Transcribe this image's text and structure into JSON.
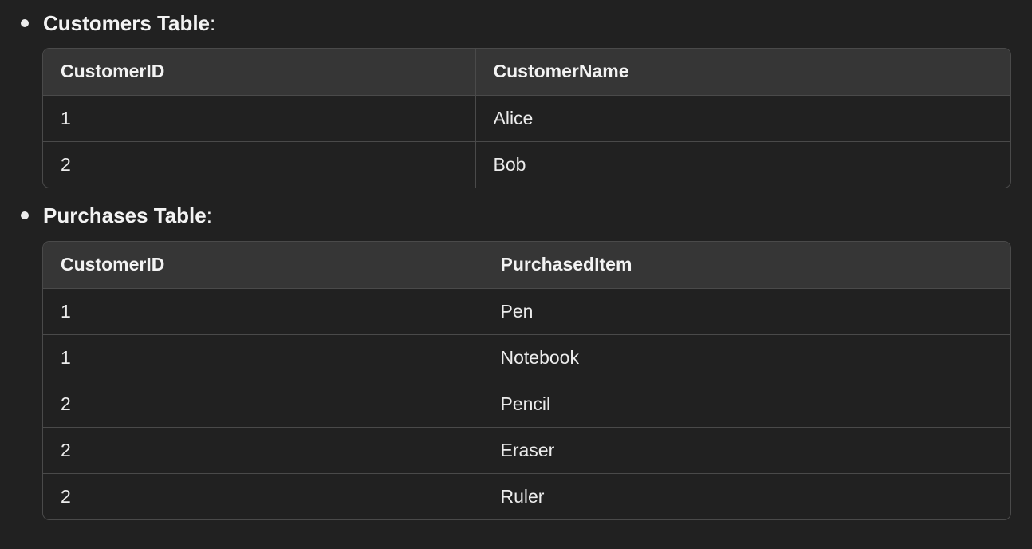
{
  "sections": [
    {
      "title": "Customers Table",
      "colon": ":",
      "columns": [
        "CustomerID",
        "CustomerName"
      ],
      "rows": [
        [
          "1",
          "Alice"
        ],
        [
          "2",
          "Bob"
        ]
      ]
    },
    {
      "title": "Purchases Table",
      "colon": ":",
      "columns": [
        "CustomerID",
        "PurchasedItem"
      ],
      "rows": [
        [
          "1",
          "Pen"
        ],
        [
          "1",
          "Notebook"
        ],
        [
          "2",
          "Pencil"
        ],
        [
          "2",
          "Eraser"
        ],
        [
          "2",
          "Ruler"
        ]
      ]
    }
  ]
}
